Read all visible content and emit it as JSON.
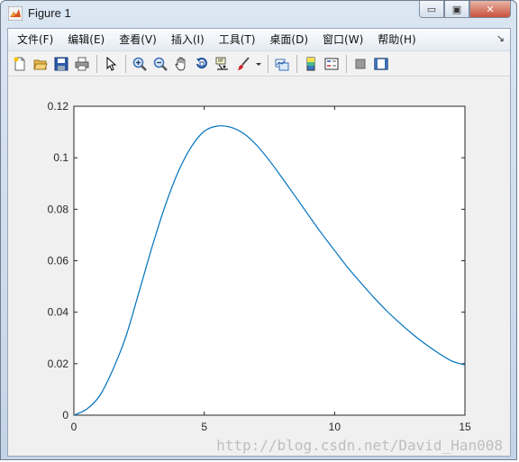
{
  "window": {
    "title": "Figure 1",
    "buttons": {
      "minimize": "▭",
      "maximize": "▣",
      "close": "✕"
    }
  },
  "menubar": {
    "items": [
      {
        "label": "文件(F)"
      },
      {
        "label": "编辑(E)"
      },
      {
        "label": "查看(V)"
      },
      {
        "label": "插入(I)"
      },
      {
        "label": "工具(T)"
      },
      {
        "label": "桌面(D)"
      },
      {
        "label": "窗口(W)"
      },
      {
        "label": "帮助(H)"
      }
    ],
    "overflow_arrow": "↘"
  },
  "toolbar": {
    "groups": [
      [
        "new-figure-icon",
        "open-file-icon",
        "save-icon",
        "print-icon"
      ],
      [
        "pointer-icon"
      ],
      [
        "zoom-in-icon",
        "zoom-out-icon",
        "pan-icon",
        "rotate-3d-icon",
        "data-cursor-icon",
        "brush-icon"
      ],
      [
        "link-plot-icon"
      ],
      [
        "colorbar-icon",
        "legend-icon"
      ],
      [
        "hide-plot-tools-icon",
        "show-plot-tools-icon"
      ]
    ]
  },
  "chart_data": {
    "type": "line",
    "title": "",
    "xlabel": "",
    "ylabel": "",
    "xlim": [
      0,
      15
    ],
    "ylim": [
      0,
      0.12
    ],
    "x_ticks": [
      "0",
      "5",
      "10",
      "15"
    ],
    "y_ticks": [
      "0",
      "0.02",
      "0.04",
      "0.06",
      "0.08",
      "0.1",
      "0.12"
    ],
    "grid": false,
    "series": [
      {
        "color": "#0072bd",
        "x": [
          0,
          0.5,
          1,
          1.5,
          2,
          2.5,
          3,
          3.5,
          4,
          4.5,
          5,
          5.5,
          6,
          6.5,
          7,
          7.5,
          8,
          8.5,
          9,
          9.5,
          10,
          10.5,
          11,
          11.5,
          12,
          12.5,
          13,
          13.5,
          14,
          14.5,
          15
        ],
        "y": [
          0,
          0.0024,
          0.0077,
          0.0178,
          0.0307,
          0.0479,
          0.0654,
          0.0813,
          0.0945,
          0.1042,
          0.1103,
          0.1123,
          0.1119,
          0.1095,
          0.105,
          0.0989,
          0.092,
          0.0849,
          0.0777,
          0.0706,
          0.064,
          0.0574,
          0.0515,
          0.0458,
          0.0405,
          0.0358,
          0.0314,
          0.0275,
          0.024,
          0.021,
          0.0195
        ]
      }
    ]
  },
  "watermark": "http://blog.csdn.net/David_Han008"
}
